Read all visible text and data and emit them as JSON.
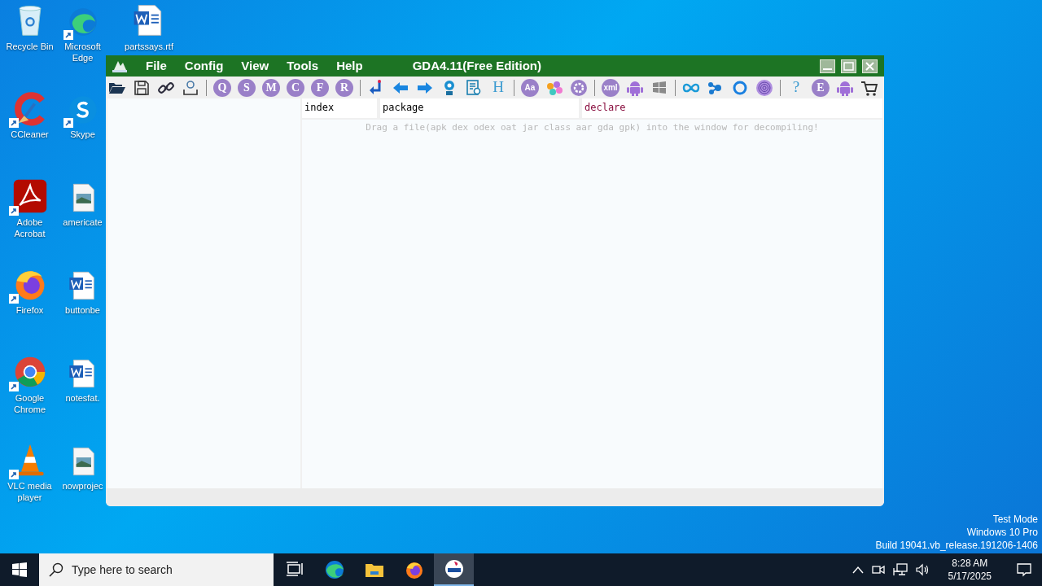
{
  "desktop": {
    "columns": [
      [
        {
          "label": "Recycle Bin",
          "kind": "recycle",
          "shortcut": false
        },
        {
          "label": "CCleaner",
          "kind": "ccleaner",
          "shortcut": true
        },
        {
          "label": "Adobe Acrobat",
          "kind": "acrobat",
          "shortcut": true
        },
        {
          "label": "Firefox",
          "kind": "firefox",
          "shortcut": true
        },
        {
          "label": "Google Chrome",
          "kind": "chrome",
          "shortcut": true
        },
        {
          "label": "VLC media player",
          "kind": "vlc",
          "shortcut": true
        }
      ],
      [
        {
          "label": "Microsoft Edge",
          "kind": "edge",
          "shortcut": true
        },
        {
          "label": "Skype",
          "kind": "skype",
          "shortcut": true
        },
        {
          "label": "americate",
          "kind": "image",
          "shortcut": false
        },
        {
          "label": "buttonbe",
          "kind": "word",
          "shortcut": false
        },
        {
          "label": "notesfat.",
          "kind": "word",
          "shortcut": false
        },
        {
          "label": "nowprojec",
          "kind": "image",
          "shortcut": false
        }
      ],
      [
        {
          "label": "partssays.rtf",
          "kind": "word",
          "shortcut": false
        }
      ]
    ]
  },
  "window": {
    "title": "GDA4.11(Free Edition)",
    "menu": [
      "File",
      "Config",
      "View",
      "Tools",
      "Help"
    ],
    "toolbar": [
      {
        "kind": "folder"
      },
      {
        "kind": "save"
      },
      {
        "kind": "link"
      },
      {
        "kind": "user"
      },
      {
        "kind": "separator"
      },
      {
        "kind": "badge",
        "text": "Q"
      },
      {
        "kind": "badge",
        "text": "S"
      },
      {
        "kind": "badge",
        "text": "M"
      },
      {
        "kind": "badge",
        "text": "C"
      },
      {
        "kind": "badge",
        "text": "F"
      },
      {
        "kind": "badge",
        "text": "R"
      },
      {
        "kind": "separator"
      },
      {
        "kind": "jump"
      },
      {
        "kind": "back"
      },
      {
        "kind": "forward"
      },
      {
        "kind": "pin"
      },
      {
        "kind": "document"
      },
      {
        "kind": "char",
        "text": "H"
      },
      {
        "kind": "separator"
      },
      {
        "kind": "badge",
        "text": "Aa"
      },
      {
        "kind": "dots"
      },
      {
        "kind": "gear"
      },
      {
        "kind": "separator"
      },
      {
        "kind": "badge",
        "text": "xml"
      },
      {
        "kind": "android"
      },
      {
        "kind": "windows"
      },
      {
        "kind": "separator"
      },
      {
        "kind": "infinity"
      },
      {
        "kind": "nodes"
      },
      {
        "kind": "ring"
      },
      {
        "kind": "fingerprint"
      },
      {
        "kind": "separator"
      },
      {
        "kind": "char",
        "text": "?"
      },
      {
        "kind": "badge",
        "text": "E"
      },
      {
        "kind": "android"
      },
      {
        "kind": "cart"
      }
    ],
    "columns": [
      {
        "label": "index",
        "kind": "plain"
      },
      {
        "label": "package",
        "kind": "plain"
      },
      {
        "label": "declare",
        "kind": "accent"
      }
    ],
    "hint": "Drag a file(apk dex odex oat jar class aar gda gpk) into the window for decompiling!"
  },
  "watermark": [
    "Test Mode",
    "Windows 10 Pro",
    "Build 19041.vb_release.191206-1406"
  ],
  "taskbar": {
    "search": {
      "placeholder": "Type here to search"
    },
    "apps": [
      {
        "kind": "taskview",
        "selected": false
      },
      {
        "kind": "edge",
        "selected": false
      },
      {
        "kind": "explorer",
        "selected": false
      },
      {
        "kind": "firefox",
        "selected": false
      },
      {
        "kind": "gda",
        "selected": true
      }
    ],
    "time": "8:28 AM",
    "date": "5/17/2025"
  }
}
